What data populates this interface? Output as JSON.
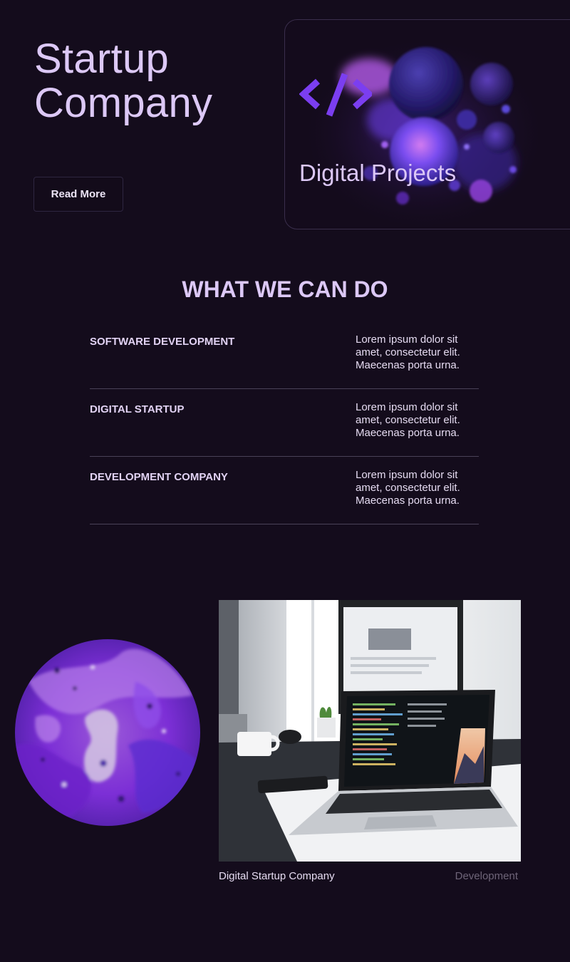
{
  "hero": {
    "title_line1": "Startup",
    "title_line2": "Company",
    "button_label": "Read More"
  },
  "card": {
    "icon": "code-icon",
    "title": "Digital Projects"
  },
  "services": {
    "heading": "WHAT WE CAN DO",
    "items": [
      {
        "name": "SOFTWARE DEVELOPMENT",
        "description": "Lorem ipsum dolor sit amet, consectetur elit. Maecenas porta urna."
      },
      {
        "name": "DIGITAL STARTUP",
        "description": "Lorem ipsum dolor sit amet, consectetur elit. Maecenas porta urna."
      },
      {
        "name": "DEVELOPMENT COMPANY",
        "description": "Lorem ipsum dolor sit amet, consectetur elit. Maecenas porta urna."
      }
    ]
  },
  "portfolio": {
    "caption": "Digital Startup Company",
    "category": "Development"
  },
  "colors": {
    "background": "#140c1c",
    "accent": "#7b3ef0",
    "heading": "#dcc8f6",
    "divider": "#4a4258"
  }
}
